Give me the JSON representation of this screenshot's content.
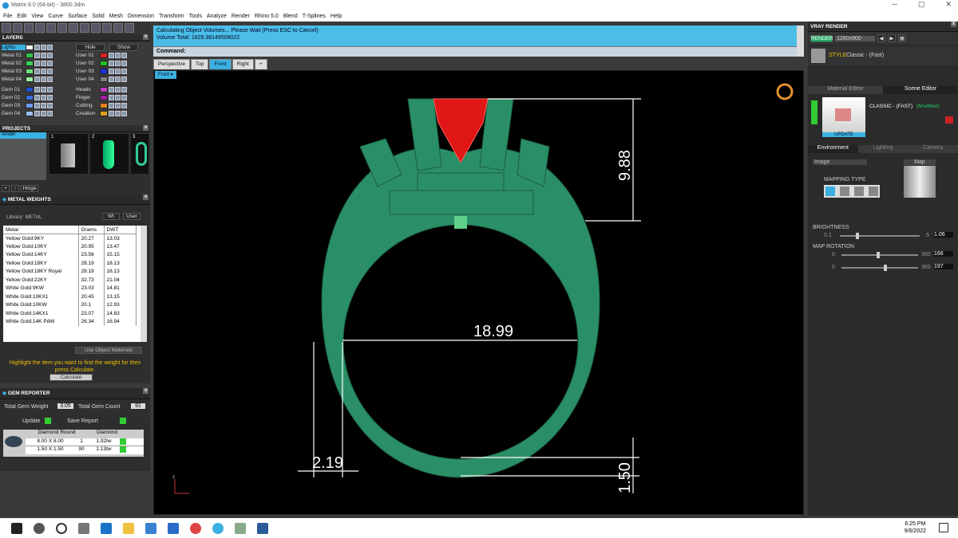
{
  "window": {
    "title": "Matrix 8.0 (64-bit) - 3800.3dm",
    "controls": [
      "─",
      "▢",
      "✕"
    ]
  },
  "menu": [
    "File",
    "Edit",
    "View",
    "Curve",
    "Surface",
    "Solid",
    "Mesh",
    "Dimension",
    "Transform",
    "Tools",
    "Analyze",
    "Render",
    "Rhino 5.0",
    "Blend",
    "T-Splines",
    "Help"
  ],
  "layers": {
    "title": "LAYERS",
    "hide": "Hide",
    "show": "Show",
    "left": [
      {
        "name": "Lights",
        "color": "#ffffff"
      },
      {
        "name": "Metal 01",
        "color": "#2fc24b"
      },
      {
        "name": "Metal 02",
        "color": "#3ad05a"
      },
      {
        "name": "Metal 03",
        "color": "#6ee27a"
      },
      {
        "name": "Metal 04",
        "color": "#9ef09e"
      },
      {
        "name": "Gem 01",
        "color": "#1f4fc8"
      },
      {
        "name": "Gem 02",
        "color": "#3a6ee0"
      },
      {
        "name": "Gem 03",
        "color": "#6a9af0"
      },
      {
        "name": "Gem 04",
        "color": "#9ac0f8"
      }
    ],
    "right": [
      {
        "name": "User 01",
        "color": "#e02020"
      },
      {
        "name": "User 02",
        "color": "#20c020"
      },
      {
        "name": "User 03",
        "color": "#2030e0"
      },
      {
        "name": "User 04",
        "color": "#808080"
      },
      {
        "name": "Heads",
        "color": "#c040c0"
      },
      {
        "name": "Finger",
        "color": "#a020a0"
      },
      {
        "name": "Cutting",
        "color": "#e08020"
      },
      {
        "name": "Creation",
        "color": "#e0a020"
      }
    ]
  },
  "projects": {
    "title": "PROJECTS",
    "item": "render",
    "thumbs": [
      "1",
      "2",
      "3"
    ],
    "hinge": "Hinge"
  },
  "metal_weights": {
    "title": "METAL WEIGHTS",
    "library_label": "Library: METAL",
    "toggle_a": "Wt",
    "toggle_b": "User",
    "columns": [
      "Metal",
      "Grams",
      "DWT"
    ],
    "rows": [
      [
        "Yellow Gold:9KY",
        "20.27",
        "13.03"
      ],
      [
        "Yellow Gold:10KY",
        "20.95",
        "13.47"
      ],
      [
        "Yellow Gold:14KY",
        "23.56",
        "15.15"
      ],
      [
        "Yellow Gold:18KY",
        "28.19",
        "18.13"
      ],
      [
        "Yellow Gold:18KY Royal",
        "28.19",
        "18.13"
      ],
      [
        "Yellow Gold:22KY",
        "32.73",
        "21.04"
      ],
      [
        "White Gold:9KW",
        "23.03",
        "14.81"
      ],
      [
        "White Gold:10KX1",
        "20.45",
        "13.15"
      ],
      [
        "White Gold:10KW",
        "20.1",
        "12.93"
      ],
      [
        "White Gold:14KX1",
        "23.07",
        "14.83"
      ],
      [
        "White Gold:14K PdW",
        "26.34",
        "16.94"
      ]
    ],
    "use_object": "Use Object Materials",
    "hint": "Highlight the item you want to find the weight for then press Calculate.",
    "calculate": "Calculate"
  },
  "gem_reporter": {
    "title": "GEM REPORTER",
    "total_weight_label": "Total Gem Weight",
    "total_weight": "3.05",
    "total_count_label": "Total Gem Count",
    "total_count": "91",
    "update": "Update",
    "save_report": "Save Report",
    "columns": [
      "Diamond Round",
      "",
      "Diamond"
    ],
    "rows": [
      [
        "8.00 X 8.00",
        "1",
        "1.92tw"
      ],
      [
        "1.50 X 1.50",
        "90",
        "1.13tw"
      ]
    ]
  },
  "command": {
    "line1": "Calculating Object Volumes... Please Wait (Press ESC to Cancel)",
    "line2": "Volume Total: 1829.38149508022",
    "prompt": "Command:"
  },
  "view_tabs": [
    {
      "label": "Perspective",
      "active": false
    },
    {
      "label": "Top",
      "active": false
    },
    {
      "label": "Front",
      "active": true
    },
    {
      "label": "Right",
      "active": false
    },
    {
      "label": "+",
      "active": false
    }
  ],
  "viewport": {
    "label": "Front",
    "axis": "z",
    "dims": {
      "height": "9.88",
      "width": "18.99",
      "shank": "2.19",
      "bottom": "1.50"
    },
    "colors": {
      "metal": "#2a8f66",
      "gem": "#e01515",
      "dim": "#ffffff"
    }
  },
  "vray": {
    "title": "VRAY RENDER",
    "render": "RENDER",
    "size": "1280x900",
    "style_label": "STYLE",
    "style": "Classic - (Fast)",
    "tabs": [
      "Material Editor",
      "Scene Editor"
    ],
    "scene_name": "CLASSIC - (FAST)",
    "modified": "(Modified)",
    "update": "UPDATE",
    "env_tabs": [
      "Environment",
      "Lighting",
      "Camera"
    ],
    "image_select": "Image",
    "map_label": "Map",
    "mapping_type": "MAPPING TYPE",
    "brightness": {
      "label": "BRIGHTNESS",
      "min": "0.1",
      "max": "5",
      "value": "1.06",
      "fraction": 0.2
    },
    "map_rotation": {
      "label": "MAP ROTATION",
      "r1": {
        "min": "0",
        "max": "360",
        "value": "166",
        "fraction": 0.46
      },
      "r2": {
        "min": "0",
        "max": "360",
        "value": "197",
        "fraction": 0.55
      }
    }
  },
  "taskbar": {
    "time": "6:25 PM",
    "date": "9/6/2022"
  }
}
